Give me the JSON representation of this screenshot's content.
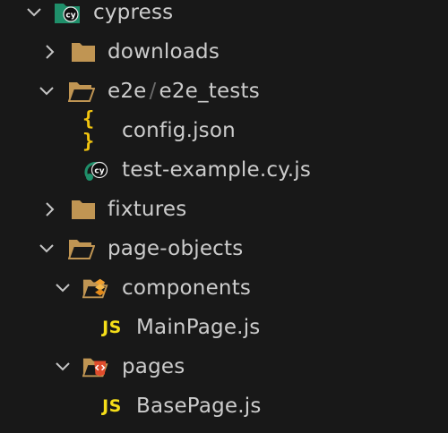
{
  "explorer": {
    "items": [
      {
        "label": "cypress",
        "icon": "cypress-folder-icon",
        "expanded": true
      },
      {
        "label": "downloads",
        "icon": "folder-icon",
        "expanded": false
      },
      {
        "label_part1": "e2e",
        "separator": "/",
        "label_part2": "e2e_tests",
        "icon": "folder-open-icon",
        "expanded": true
      },
      {
        "label": "config.json",
        "icon": "json-braces-icon"
      },
      {
        "label": "test-example.cy.js",
        "icon": "cypress-test-file-icon"
      },
      {
        "label": "fixtures",
        "icon": "folder-icon",
        "expanded": false
      },
      {
        "label": "page-objects",
        "icon": "folder-open-icon",
        "expanded": true
      },
      {
        "label": "components",
        "icon": "components-folder-icon",
        "expanded": true
      },
      {
        "label": "MainPage.js",
        "icon": "js-file-icon",
        "icon_text": "JS"
      },
      {
        "label": "pages",
        "icon": "pages-folder-icon",
        "expanded": true
      },
      {
        "label": "BasePage.js",
        "icon": "js-file-icon",
        "icon_text": "JS"
      }
    ],
    "json_icon_text": "{ }"
  },
  "colors": {
    "background": "#181818",
    "text": "#cccccc",
    "folder": "#c09553",
    "json": "#f1c40f",
    "js": "#f5de19",
    "cypress": "#1f8f6a",
    "components_accent": "#f0a030",
    "pages_accent": "#e04c2c"
  }
}
